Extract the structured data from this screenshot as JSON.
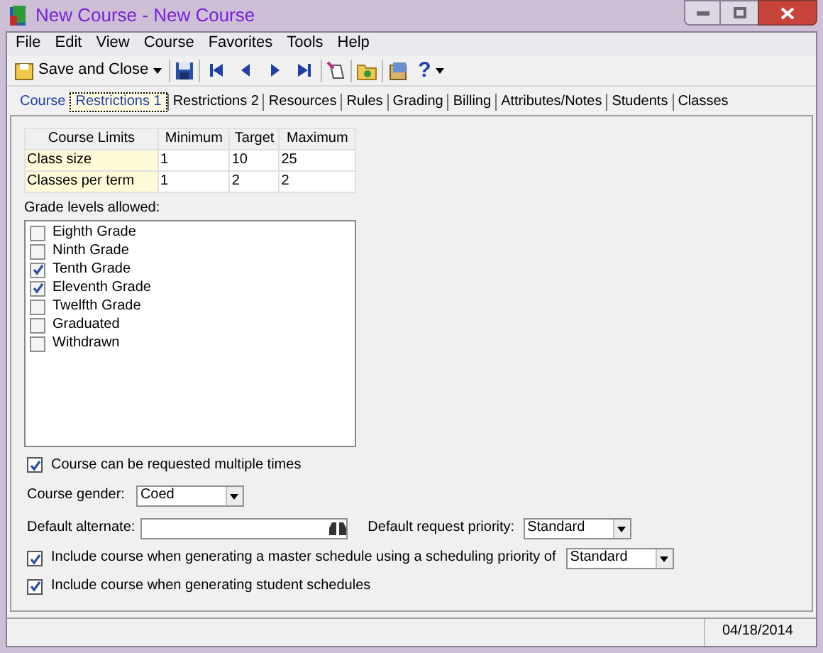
{
  "window": {
    "title": "New Course - New Course"
  },
  "menu": [
    "File",
    "Edit",
    "View",
    "Course",
    "Favorites",
    "Tools",
    "Help"
  ],
  "toolbar": {
    "save_close": "Save and Close",
    "help": "?"
  },
  "tabs": [
    {
      "label": "Course",
      "selected": false
    },
    {
      "label": "Restrictions 1",
      "selected": true
    },
    {
      "label": "Restrictions 2",
      "selected": false
    },
    {
      "label": "Resources",
      "selected": false
    },
    {
      "label": "Rules",
      "selected": false
    },
    {
      "label": "Grading",
      "selected": false
    },
    {
      "label": "Billing",
      "selected": false
    },
    {
      "label": "Attributes/Notes",
      "selected": false
    },
    {
      "label": "Students",
      "selected": false
    },
    {
      "label": "Classes",
      "selected": false
    }
  ],
  "limits": {
    "columns": [
      "Course Limits",
      "Minimum",
      "Target",
      "Maximum"
    ],
    "rows": [
      [
        "Class size",
        "1",
        "10",
        "25"
      ],
      [
        "Classes per term",
        "1",
        "2",
        "2"
      ]
    ]
  },
  "grades": {
    "label": "Grade levels allowed:",
    "items": [
      {
        "label": "Eighth Grade",
        "checked": false
      },
      {
        "label": "Ninth Grade",
        "checked": false
      },
      {
        "label": "Tenth Grade",
        "checked": true
      },
      {
        "label": "Eleventh Grade",
        "checked": true
      },
      {
        "label": "Twelfth Grade",
        "checked": false
      },
      {
        "label": "Graduated",
        "checked": false
      },
      {
        "label": "Withdrawn",
        "checked": false
      }
    ]
  },
  "multiple": {
    "label": "Course can be requested multiple times",
    "checked": true
  },
  "gender": {
    "label": "Course gender:",
    "value": "Coed"
  },
  "alternate": {
    "label": "Default alternate:"
  },
  "request_priority": {
    "label": "Default request priority:",
    "value": "Standard"
  },
  "master": {
    "label": "Include course when generating a master schedule using a scheduling priority of",
    "checked": true,
    "value": "Standard"
  },
  "student": {
    "label": "Include course when generating student schedules",
    "checked": true
  },
  "status_bar": {
    "date": "04/18/2014"
  }
}
